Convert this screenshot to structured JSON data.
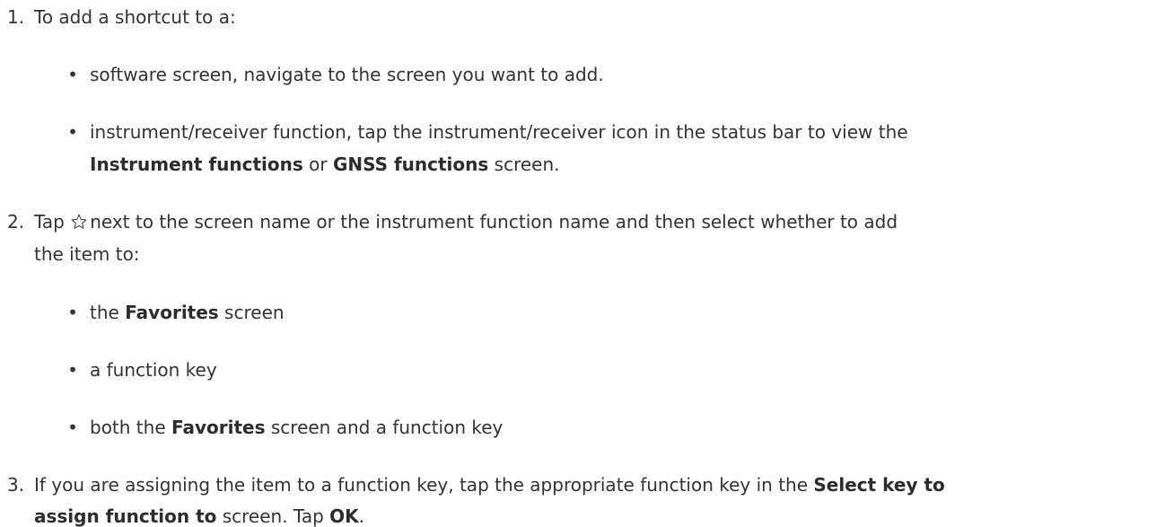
{
  "steps": [
    {
      "number": "1.",
      "intro": "To add a shortcut to a:",
      "bullets": [
        {
          "text": "software screen, navigate to the screen you want to add."
        },
        {
          "text_line1": "instrument/receiver function, tap the instrument/receiver icon in the status bar to view the",
          "bold1": "Instrument functions",
          "mid": " or ",
          "bold2": "GNSS functions",
          "end": " screen."
        }
      ]
    },
    {
      "number": "2.",
      "pre": "Tap ",
      "line1_rest": "next to the screen name or the instrument function name and then select whether to add",
      "line2": "the item to:",
      "bullets": [
        {
          "pre": "the ",
          "bold": "Favorites",
          "post": " screen"
        },
        {
          "text": "a function key"
        },
        {
          "pre": "both the ",
          "bold": "Favorites",
          "post": " screen and a function key"
        }
      ]
    },
    {
      "number": "3.",
      "line1_pre": "If you are assigning the item to a function key, tap the appropriate function key in the ",
      "line1_bold": "Select key to",
      "line2_bold": "assign function to",
      "line2_mid": " screen. Tap ",
      "line2_bold2": "OK",
      "line2_end": "."
    }
  ],
  "bullet_glyph": "•",
  "icons": {
    "star": "star-outline-icon"
  }
}
